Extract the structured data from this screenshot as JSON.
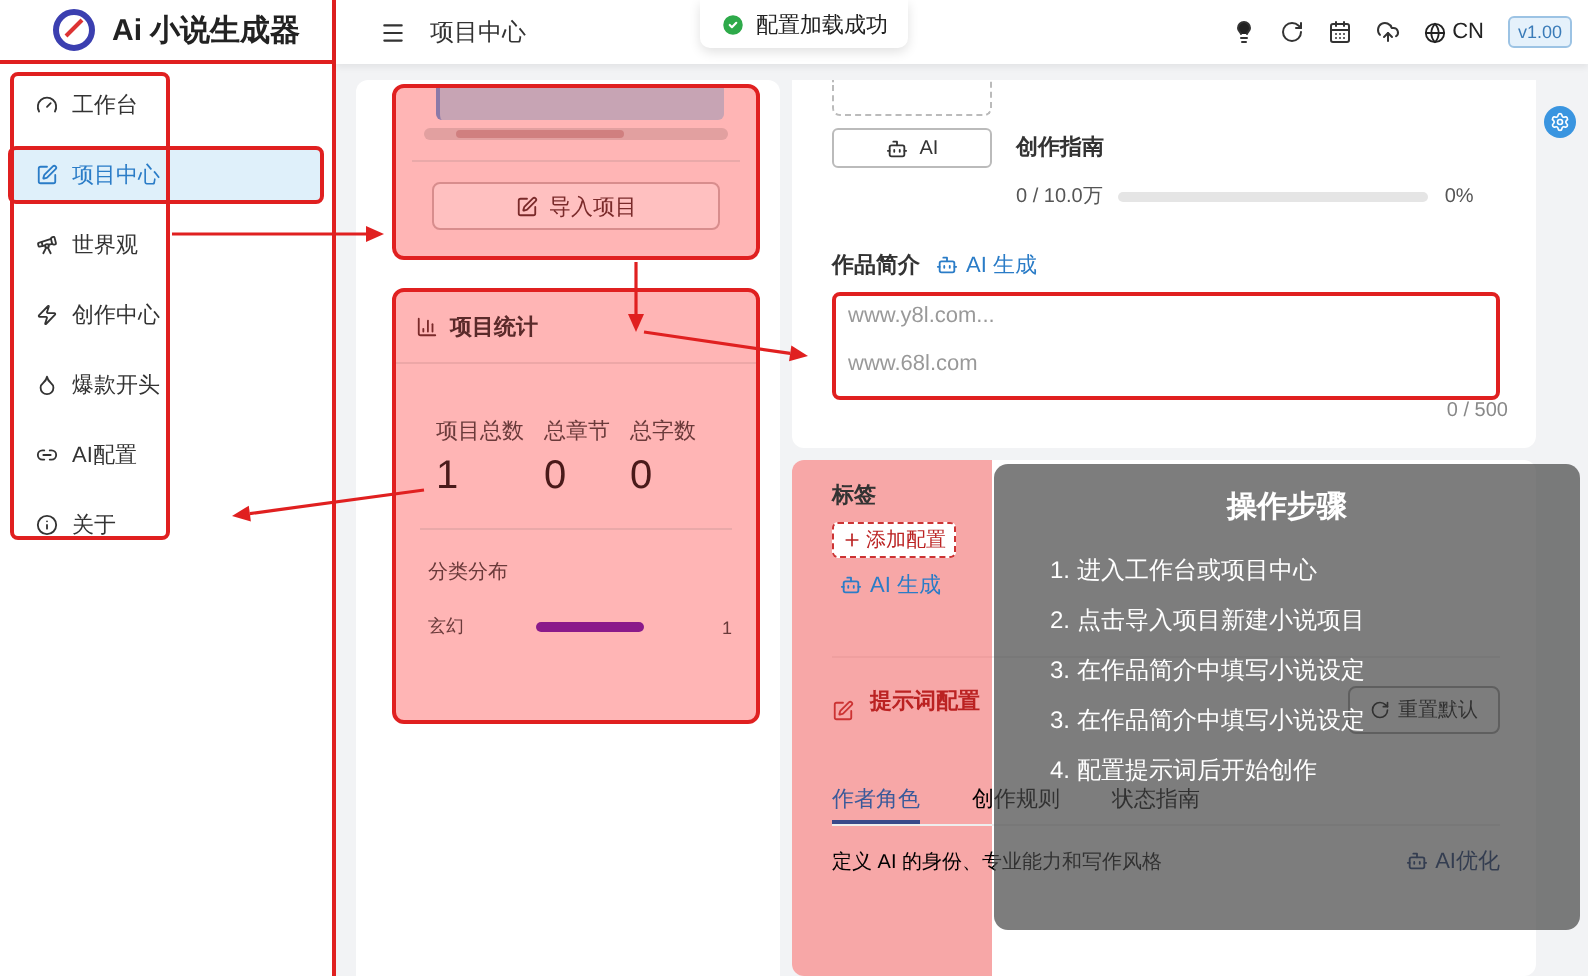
{
  "app": {
    "title": "Ai 小说生成器"
  },
  "sidebar": {
    "items": [
      {
        "label": "工作台",
        "selected": false
      },
      {
        "label": "项目中心",
        "selected": true
      },
      {
        "label": "世界观",
        "selected": false
      },
      {
        "label": "创作中心",
        "selected": false
      },
      {
        "label": "爆款开头",
        "selected": false
      },
      {
        "label": "AI配置",
        "selected": false
      },
      {
        "label": "关于",
        "selected": false
      }
    ]
  },
  "header": {
    "title": "项目中心",
    "language": "CN",
    "version": "v1.00"
  },
  "toast": {
    "message": "配置加载成功"
  },
  "import_card": {
    "button": "导入项目"
  },
  "stats_card": {
    "title": "项目统计",
    "stats": [
      {
        "label": "项目总数",
        "value": "1"
      },
      {
        "label": "总章节",
        "value": "0"
      },
      {
        "label": "总字数",
        "value": "0"
      }
    ],
    "distribution_title": "分类分布",
    "categories": [
      {
        "label": "玄幻",
        "level": 1,
        "count": "1"
      }
    ]
  },
  "editor": {
    "ai_button": "AI",
    "guide": {
      "title": "创作指南",
      "reading": "0 / 10.0万",
      "level": 0,
      "percent": "0%"
    },
    "intro": {
      "label": "作品简介",
      "ai_link": "AI 生成",
      "placeholder": "www.y8l.com...\n\nwww.68l.com",
      "counter": "0 / 500"
    }
  },
  "tags": {
    "label": "标签",
    "add_button": "添加配置",
    "ai_link": "AI 生成"
  },
  "prompt": {
    "title": "提示词配置",
    "reset_button": "重置默认",
    "tabs": [
      {
        "label": "作者角色",
        "selected": true
      },
      {
        "label": "创作规则",
        "selected": false
      },
      {
        "label": "状态指南",
        "selected": false
      }
    ],
    "description": "定义 AI 的身份、专业能力和写作风格",
    "ai_button": "AI优化"
  },
  "steps": {
    "title": "操作步骤",
    "items": [
      "1. 进入工作台或项目中心",
      "2. 点击导入项目新建小说项目",
      "3. 在作品简介中填写小说设定",
      "3. 在作品简介中填写小说设定",
      "4. 配置提示词后开始创作"
    ]
  }
}
